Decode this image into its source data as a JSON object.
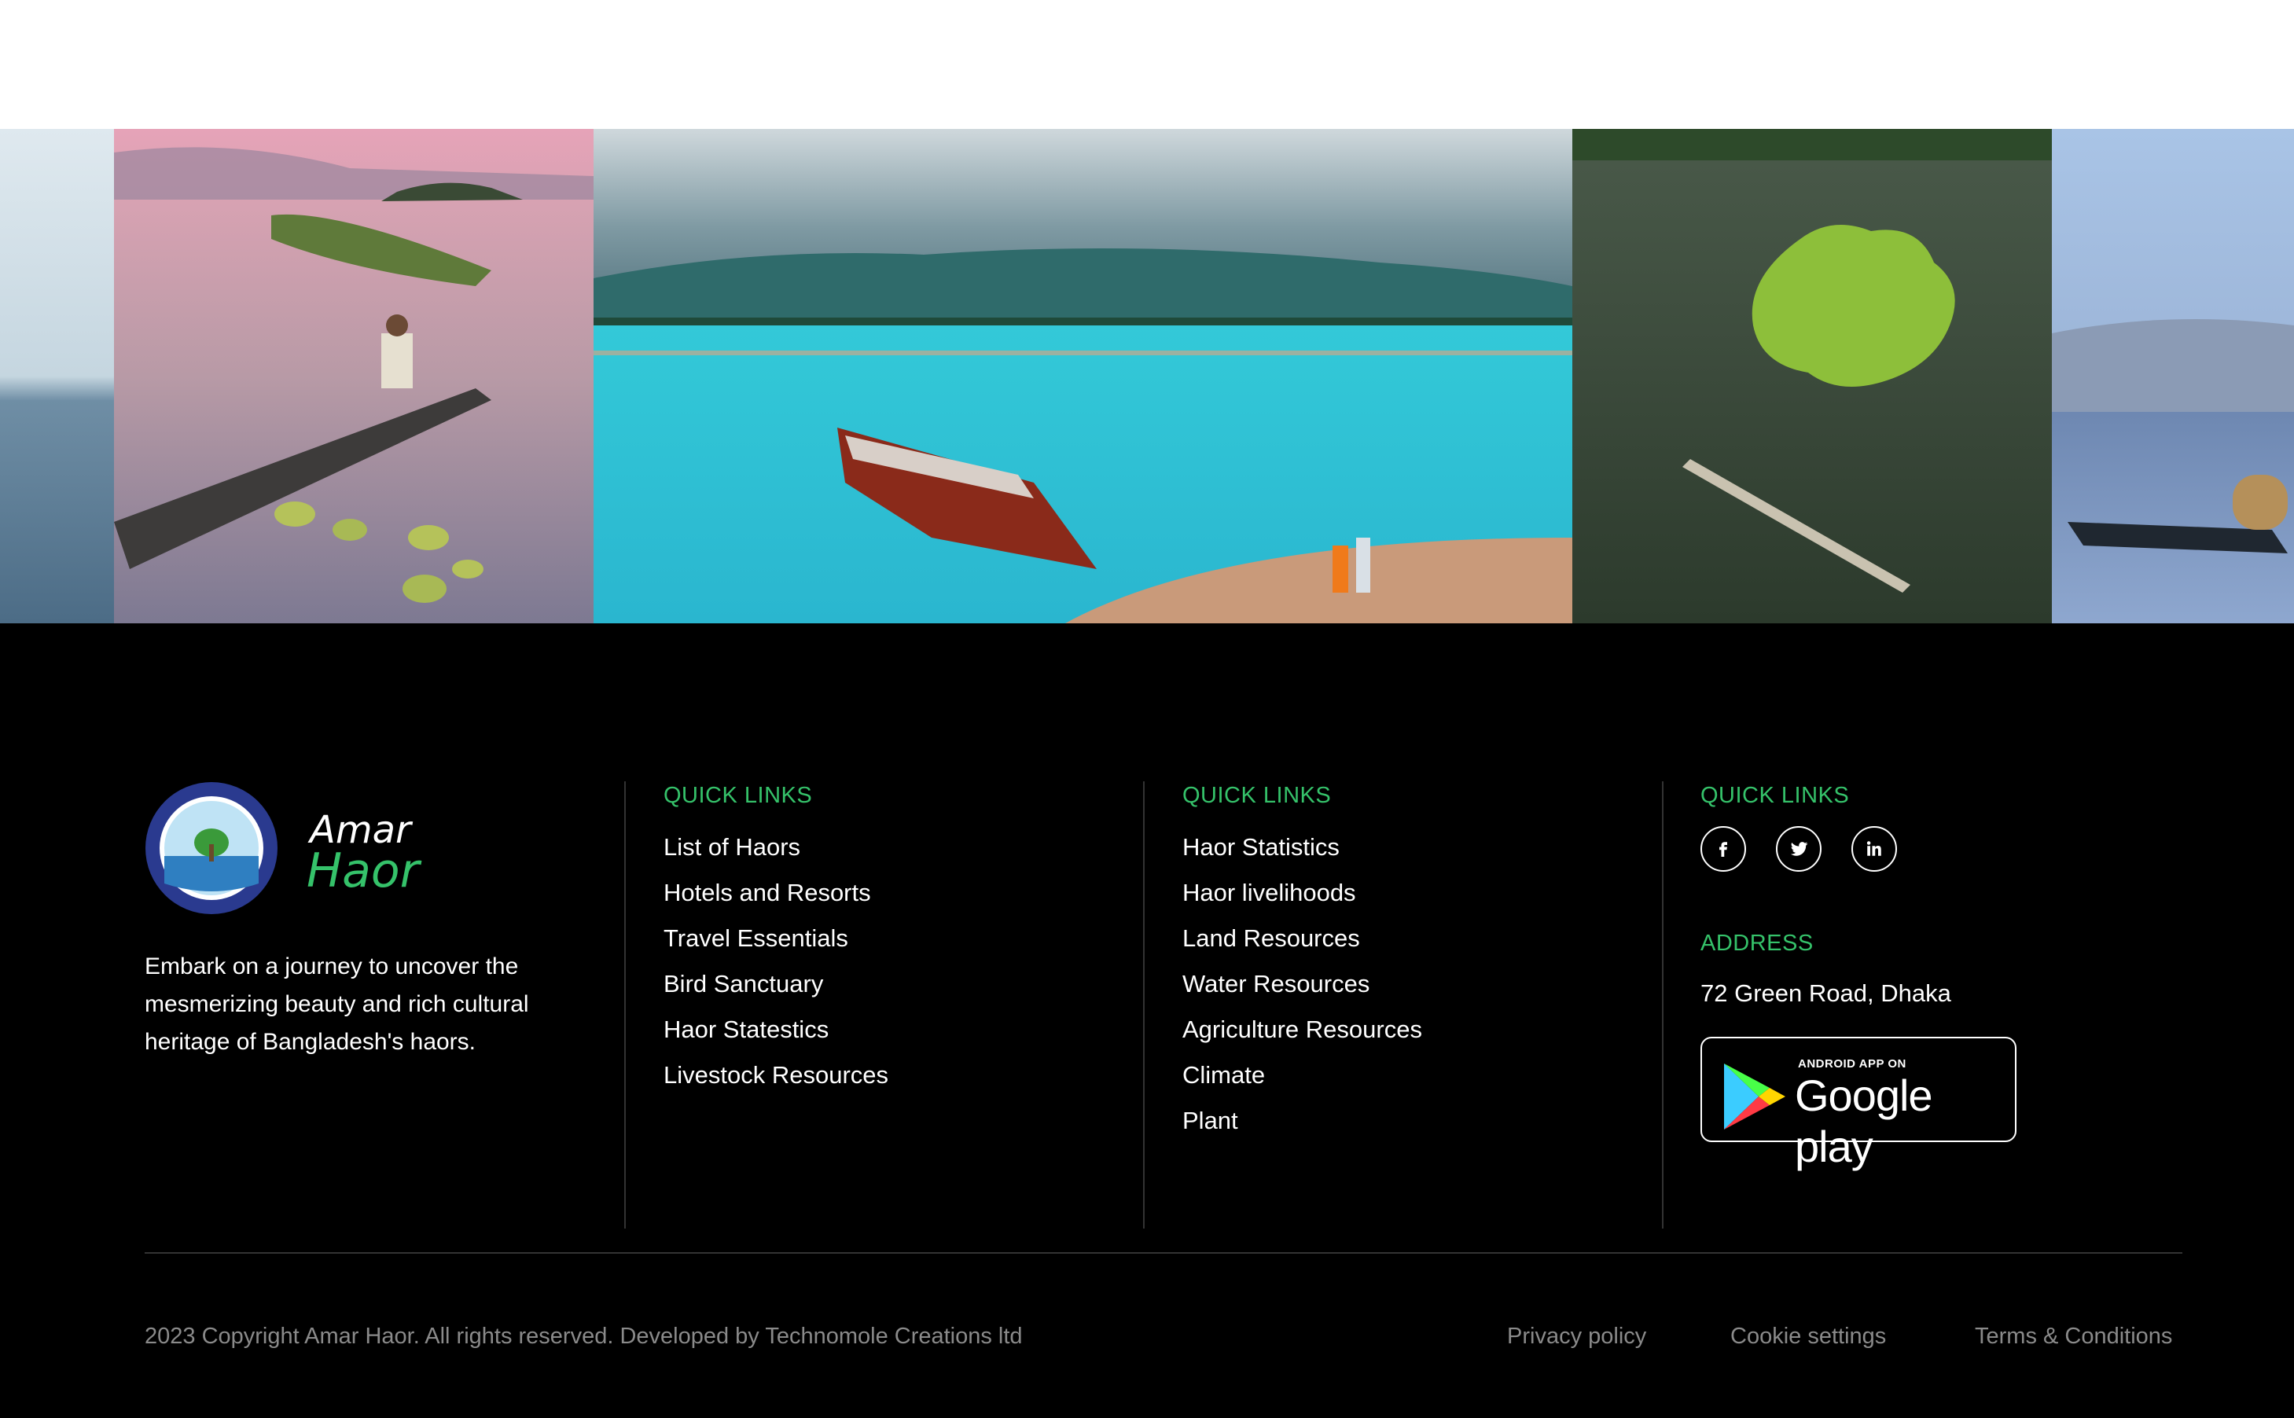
{
  "brand": {
    "wordmark_line1": "Amar",
    "wordmark_line2": "Haor",
    "description": "Embark on a journey to uncover the mesmerizing beauty and rich cultural heritage of Bangladesh's haors."
  },
  "columns": {
    "links1": {
      "heading": "QUICK LINKS",
      "items": [
        "List of Haors",
        "Hotels and Resorts",
        "Travel Essentials",
        "Bird Sanctuary",
        "Haor Statestics",
        "Livestock Resources"
      ]
    },
    "links2": {
      "heading": "QUICK LINKS",
      "items": [
        "Haor Statistics",
        "Haor livelihoods",
        "Land Resources",
        "Water Resources",
        "Agriculture Resources",
        "Climate",
        "Plant"
      ]
    },
    "social": {
      "heading": "QUICK LINKS",
      "icons": [
        "facebook-icon",
        "twitter-icon",
        "linkedin-icon"
      ],
      "address_heading": "ADDRESS",
      "address": "72 Green Road, Dhaka"
    }
  },
  "play_badge": {
    "small": "ANDROID APP ON",
    "big": "Google play"
  },
  "bottom": {
    "copyright": "2023 Copyright Amar Haor. All rights reserved. Developed by Technomole Creations ltd",
    "privacy": "Privacy policy",
    "cookies": "Cookie settings",
    "terms": "Terms & Conditions"
  },
  "colors": {
    "accent_green": "#35c26a",
    "footer_bg": "#000000",
    "muted_text": "#8a8a8a"
  }
}
